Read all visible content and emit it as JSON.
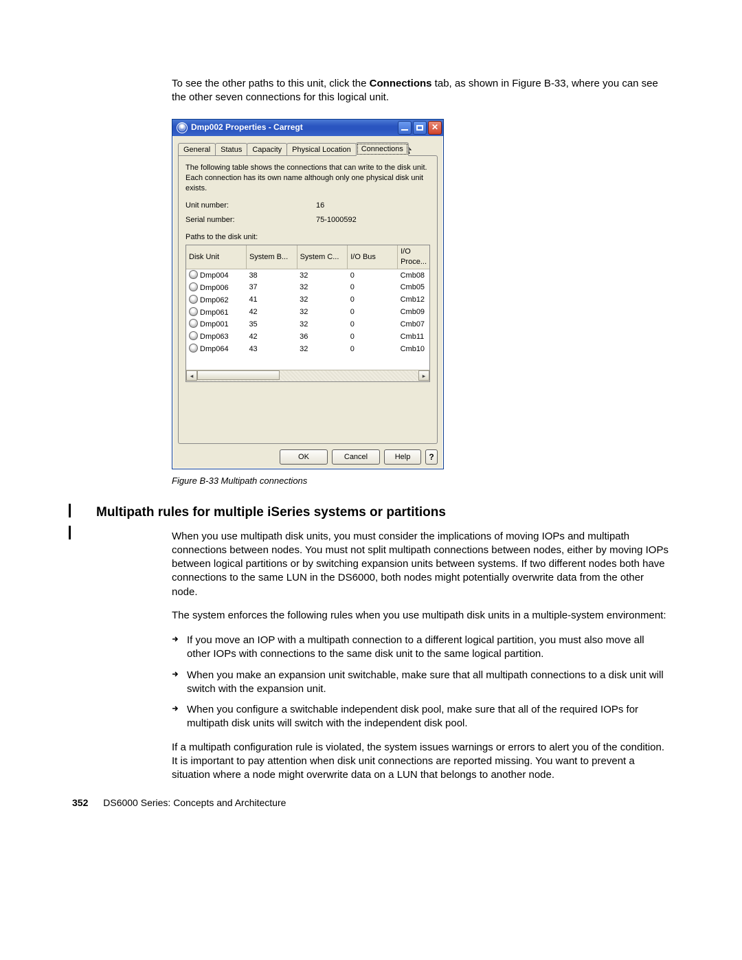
{
  "intro": {
    "pre": "To see the other paths to this unit, click the ",
    "bold": "Connections",
    "post": " tab, as shown in Figure B-33, where you can see the other seven connections for this logical unit."
  },
  "dialog": {
    "title": "Dmp002 Properties - Carregt",
    "tabs": [
      "General",
      "Status",
      "Capacity",
      "Physical Location",
      "Connections"
    ],
    "desc": "The following table shows the connections that can write to the disk unit.  Each connection has its own name although only one physical disk unit exists.",
    "unit_label": "Unit number:",
    "unit_val": "16",
    "serial_label": "Serial number:",
    "serial_val": "75-1000592",
    "paths_label": "Paths to the disk unit:",
    "columns": [
      "Disk Unit",
      "System B...",
      "System C...",
      "I/O Bus",
      "I/O Proce..."
    ],
    "rows": [
      {
        "du": "Dmp004",
        "b": "38",
        "c": "32",
        "io": "0",
        "p": "Cmb08"
      },
      {
        "du": "Dmp006",
        "b": "37",
        "c": "32",
        "io": "0",
        "p": "Cmb05"
      },
      {
        "du": "Dmp062",
        "b": "41",
        "c": "32",
        "io": "0",
        "p": "Cmb12"
      },
      {
        "du": "Dmp061",
        "b": "42",
        "c": "32",
        "io": "0",
        "p": "Cmb09"
      },
      {
        "du": "Dmp001",
        "b": "35",
        "c": "32",
        "io": "0",
        "p": "Cmb07"
      },
      {
        "du": "Dmp063",
        "b": "42",
        "c": "36",
        "io": "0",
        "p": "Cmb11"
      },
      {
        "du": "Dmp064",
        "b": "43",
        "c": "32",
        "io": "0",
        "p": "Cmb10"
      }
    ],
    "ok": "OK",
    "cancel": "Cancel",
    "help": "Help"
  },
  "caption": "Figure B-33   Multipath connections",
  "heading": "Multipath rules for multiple iSeries systems or partitions",
  "para1": "When you use multipath disk units, you must consider the implications of moving IOPs and multipath connections between nodes. You must not split multipath connections between nodes, either by moving IOPs between logical partitions or by switching expansion units between systems. If two different nodes both have connections to the same LUN in the DS6000, both nodes might potentially overwrite data from the other node.",
  "para2": "The system enforces the following rules when you use multipath disk units in a multiple-system environment:",
  "bullets": [
    "If you move an IOP with a multipath connection to a different logical partition, you must also move all other IOPs with connections to the same disk unit to the same logical partition.",
    "When you make an expansion unit switchable, make sure that all multipath connections to a disk unit will switch with the expansion unit.",
    "When you configure a switchable independent disk pool, make sure that all of the required IOPs for multipath disk units will switch with the independent disk pool."
  ],
  "para3": "If a multipath configuration rule is violated, the system issues warnings or errors to alert you of the condition. It is important to pay attention when disk unit connections are reported missing. You want to prevent a situation where a node might overwrite data on a LUN that belongs to another node.",
  "footer_page": "352",
  "footer_title": "DS6000 Series: Concepts and Architecture"
}
